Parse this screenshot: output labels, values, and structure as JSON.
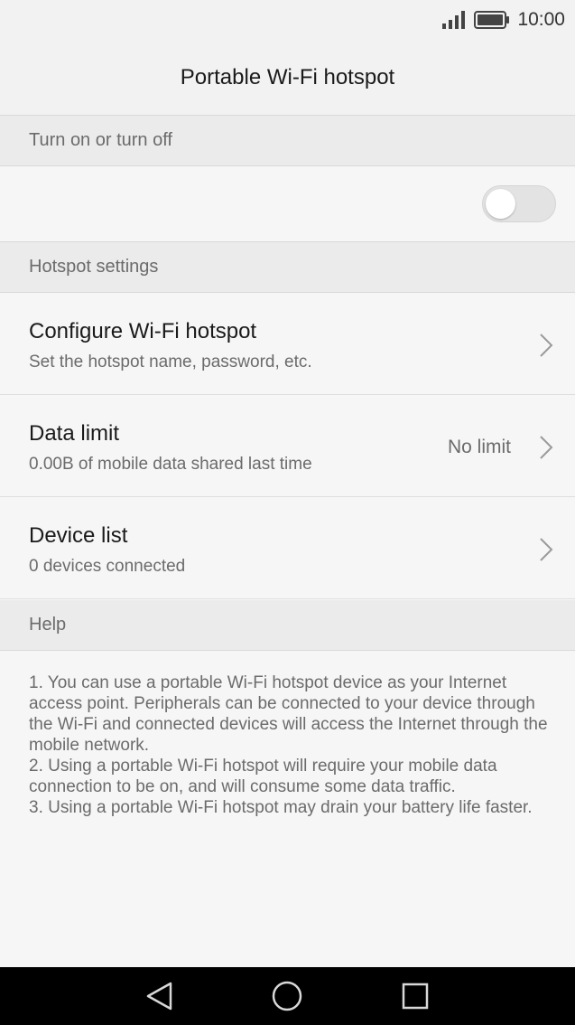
{
  "status_bar": {
    "time": "10:00",
    "signal_icon": "signal-icon",
    "battery_icon": "battery-icon"
  },
  "header": {
    "title": "Portable Wi-Fi hotspot"
  },
  "sections": {
    "toggle_header": "Turn on or turn off",
    "hotspot_settings_header": "Hotspot settings",
    "help_header": "Help"
  },
  "hotspot_toggle": {
    "state": "off"
  },
  "items": [
    {
      "title": "Configure Wi-Fi hotspot",
      "subtitle": "Set the hotspot name, password, etc.",
      "value": ""
    },
    {
      "title": "Data limit",
      "subtitle": "0.00B of mobile data shared last time",
      "value": "No limit"
    },
    {
      "title": "Device list",
      "subtitle": "0 devices connected",
      "value": ""
    }
  ],
  "help": {
    "lines": [
      "1. You can use a portable Wi-Fi hotspot device as your Internet access point. Peripherals can be connected to your device through the Wi-Fi and connected devices will access the Internet through the mobile network.",
      "2. Using a portable Wi-Fi hotspot will require your mobile data connection to be on, and will consume some data traffic.",
      "3. Using a portable Wi-Fi hotspot may drain your battery life faster."
    ]
  },
  "nav_bar": {
    "back_icon": "back-triangle-icon",
    "home_icon": "home-circle-icon",
    "recents_icon": "recents-square-icon"
  }
}
